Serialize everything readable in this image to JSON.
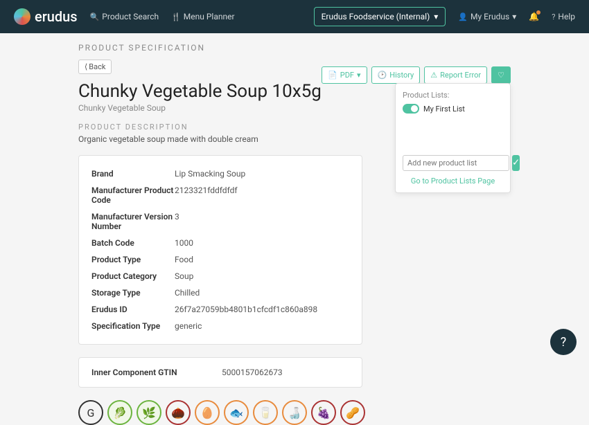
{
  "topbar": {
    "brand": "erudus",
    "product_search": "Product Search",
    "menu_planner": "Menu Planner",
    "account_selector": "Erudus Foodservice (Internal)",
    "my_erudus": "My Erudus",
    "help": "Help"
  },
  "page_label": "PRODUCT SPECIFICATION",
  "back_label": "Back",
  "actions": {
    "pdf": "PDF",
    "history": "History",
    "report_error": "Report Error"
  },
  "product": {
    "title": "Chunky Vegetable Soup 10x5g",
    "subtitle": "Chunky Vegetable Soup",
    "desc_label": "PRODUCT DESCRIPTION",
    "desc": "Organic vegetable soup made with double cream"
  },
  "spec": [
    {
      "label": "Brand",
      "value": "Lip Smacking Soup"
    },
    {
      "label": "Manufacturer Product Code",
      "value": "2123321fddfdfdf"
    },
    {
      "label": "Manufacturer Version Number",
      "value": "3"
    },
    {
      "label": "Batch Code",
      "value": "1000"
    },
    {
      "label": "Product Type",
      "value": "Food"
    },
    {
      "label": "Product Category",
      "value": "Soup"
    },
    {
      "label": "Storage Type",
      "value": "Chilled"
    },
    {
      "label": "Erudus ID",
      "value": "26f7a27059bb4801b1cfcdf1c860a898"
    },
    {
      "label": "Specification Type",
      "value": "generic"
    }
  ],
  "gtin": {
    "label": "Inner Component GTIN",
    "value": "5000157062673"
  },
  "popup": {
    "title": "Product Lists:",
    "item": "My First List",
    "placeholder": "Add new product list",
    "link": "Go to Product Lists Page"
  }
}
